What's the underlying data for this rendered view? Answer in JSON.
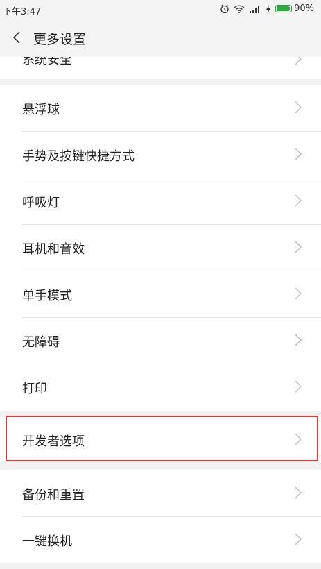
{
  "status_bar": {
    "time": "下午3:47",
    "battery_percent": 90,
    "battery_label": "90%",
    "icons": [
      "alarm-icon",
      "wifi-icon",
      "signal-icon",
      "charging-icon",
      "battery-icon"
    ]
  },
  "header": {
    "title": "更多设置",
    "back_icon": "chevron-left-icon"
  },
  "partial_item": {
    "label": "系统安全"
  },
  "items": [
    {
      "label": "悬浮球"
    },
    {
      "label": "手势及按键快捷方式"
    },
    {
      "label": "呼吸灯"
    },
    {
      "label": "耳机和音效"
    },
    {
      "label": "单手模式"
    },
    {
      "label": "无障碍"
    },
    {
      "label": "打印"
    },
    {
      "label": "开发者选项"
    },
    {
      "label": "备份和重置"
    },
    {
      "label": "一键换机"
    }
  ],
  "colors": {
    "highlight": "#e03b3b",
    "battery": "#2eaa42",
    "background": "#f2f2f2"
  }
}
